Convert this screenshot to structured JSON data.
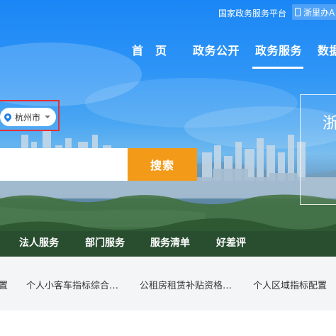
{
  "topbar": {
    "platform_link": "国家政务服务平台",
    "mobile_link": "浙里办A"
  },
  "nav": {
    "items": [
      {
        "label": "首　页"
      },
      {
        "label": "政务公开"
      },
      {
        "label": "政务服务"
      },
      {
        "label": "数据"
      }
    ],
    "active": "政务服务"
  },
  "location": {
    "city": "杭州市"
  },
  "search": {
    "value": "",
    "placeholder": "",
    "button_label": "搜索"
  },
  "side_card": {
    "text": "浙"
  },
  "services": [
    {
      "label": "法人服务"
    },
    {
      "label": "部门服务"
    },
    {
      "label": "服务清单"
    },
    {
      "label": "好差评"
    }
  ],
  "hot_items": [
    {
      "label": "置"
    },
    {
      "label": "个人小客车指标综合…"
    },
    {
      "label": "公租房租赁补贴资格…"
    },
    {
      "label": "个人区域指标配置"
    }
  ],
  "colors": {
    "sky": "#1a86f5",
    "accent": "#f39a18",
    "highlight": "#e2303a",
    "pin": "#1a7fe8"
  }
}
